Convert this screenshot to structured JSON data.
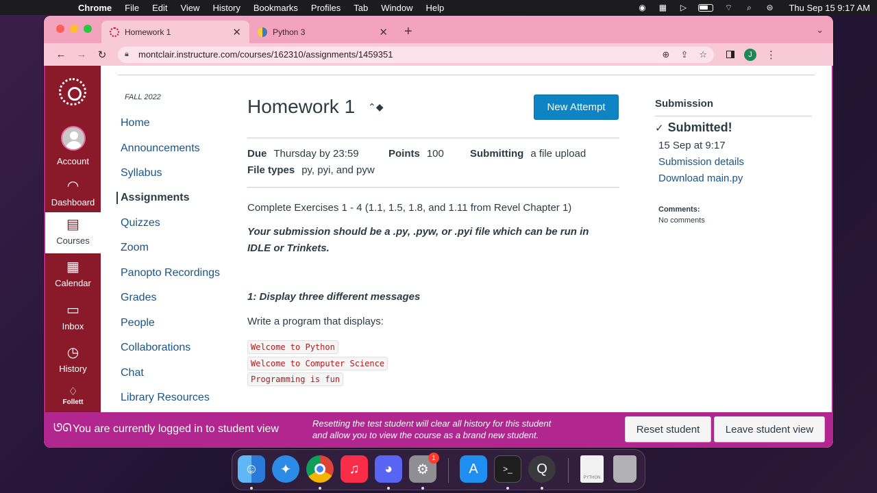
{
  "menubar": {
    "app": "Chrome",
    "menus": [
      "File",
      "Edit",
      "View",
      "History",
      "Bookmarks",
      "Profiles",
      "Tab",
      "Window",
      "Help"
    ],
    "clock": "Thu Sep 15  9:17 AM"
  },
  "browser": {
    "tabs": [
      {
        "title": "Homework 1",
        "active": true
      },
      {
        "title": "Python 3",
        "active": false
      }
    ],
    "url": "montclair.instructure.com/courses/162310/assignments/1459351",
    "profile_initial": "J"
  },
  "global_nav": [
    {
      "label": "Account",
      "icon": "account-avatar"
    },
    {
      "label": "Dashboard",
      "icon": "dashboard-icon"
    },
    {
      "label": "Courses",
      "icon": "courses-icon",
      "active": true
    },
    {
      "label": "Calendar",
      "icon": "calendar-icon"
    },
    {
      "label": "Inbox",
      "icon": "inbox-icon"
    },
    {
      "label": "History",
      "icon": "history-icon"
    },
    {
      "label": "Follett",
      "icon": "follett-icon"
    }
  ],
  "course_nav": {
    "term": "FALL 2022",
    "items": [
      "Home",
      "Announcements",
      "Syllabus",
      "Assignments",
      "Quizzes",
      "Zoom",
      "Panopto Recordings",
      "Grades",
      "People",
      "Collaborations",
      "Chat",
      "Library Resources"
    ],
    "active": "Assignments"
  },
  "assignment": {
    "title": "Homework 1",
    "new_attempt_label": "New Attempt",
    "due_label": "Due",
    "due_value": "Thursday by 23:59",
    "points_label": "Points",
    "points_value": "100",
    "submitting_label": "Submitting",
    "submitting_value": "a file upload",
    "filetypes_label": "File types",
    "filetypes_value": "py, pyi, and pyw",
    "intro": "Complete Exercises 1 - 4 (1.1, 1.5, 1.8, and 1.11 from Revel Chapter 1)",
    "instruction": "Your submission should be a .py, .pyw, or .pyi file which can be run in IDLE or Trinkets.",
    "ex1_heading": "1: Display three different messages",
    "ex1_text": "Write a program that displays:",
    "code_lines": [
      "Welcome to Python",
      "Welcome to Computer Science",
      "Programming is fun"
    ]
  },
  "submission": {
    "heading": "Submission",
    "status": "Submitted!",
    "date": "15 Sep at 9:17",
    "details_link": "Submission details",
    "download_link": "Download main.py",
    "comments_label": "Comments:",
    "comments_value": "No comments"
  },
  "student_view": {
    "message": "You are currently logged in to student view",
    "note": "Resetting the test student will clear all history for this student and allow you to view the course as a brand new student.",
    "reset_label": "Reset student",
    "leave_label": "Leave student view"
  },
  "dock": {
    "apps": [
      "finder-icon",
      "safari-icon",
      "chrome-icon",
      "music-icon",
      "discord-icon",
      "system-preferences-icon",
      "app-store-icon",
      "terminal-icon",
      "quicktime-icon",
      "python-file-icon",
      "trash-icon"
    ],
    "system_preferences_badge": "1",
    "python_file_label": "PYTHON"
  },
  "colors": {
    "canvas_red": "#8a1a2a",
    "student_view_magenta": "#b1268f",
    "link_blue": "#1a5486",
    "button_blue": "#0e84c4",
    "tab_pink": "#f3a3bd"
  }
}
